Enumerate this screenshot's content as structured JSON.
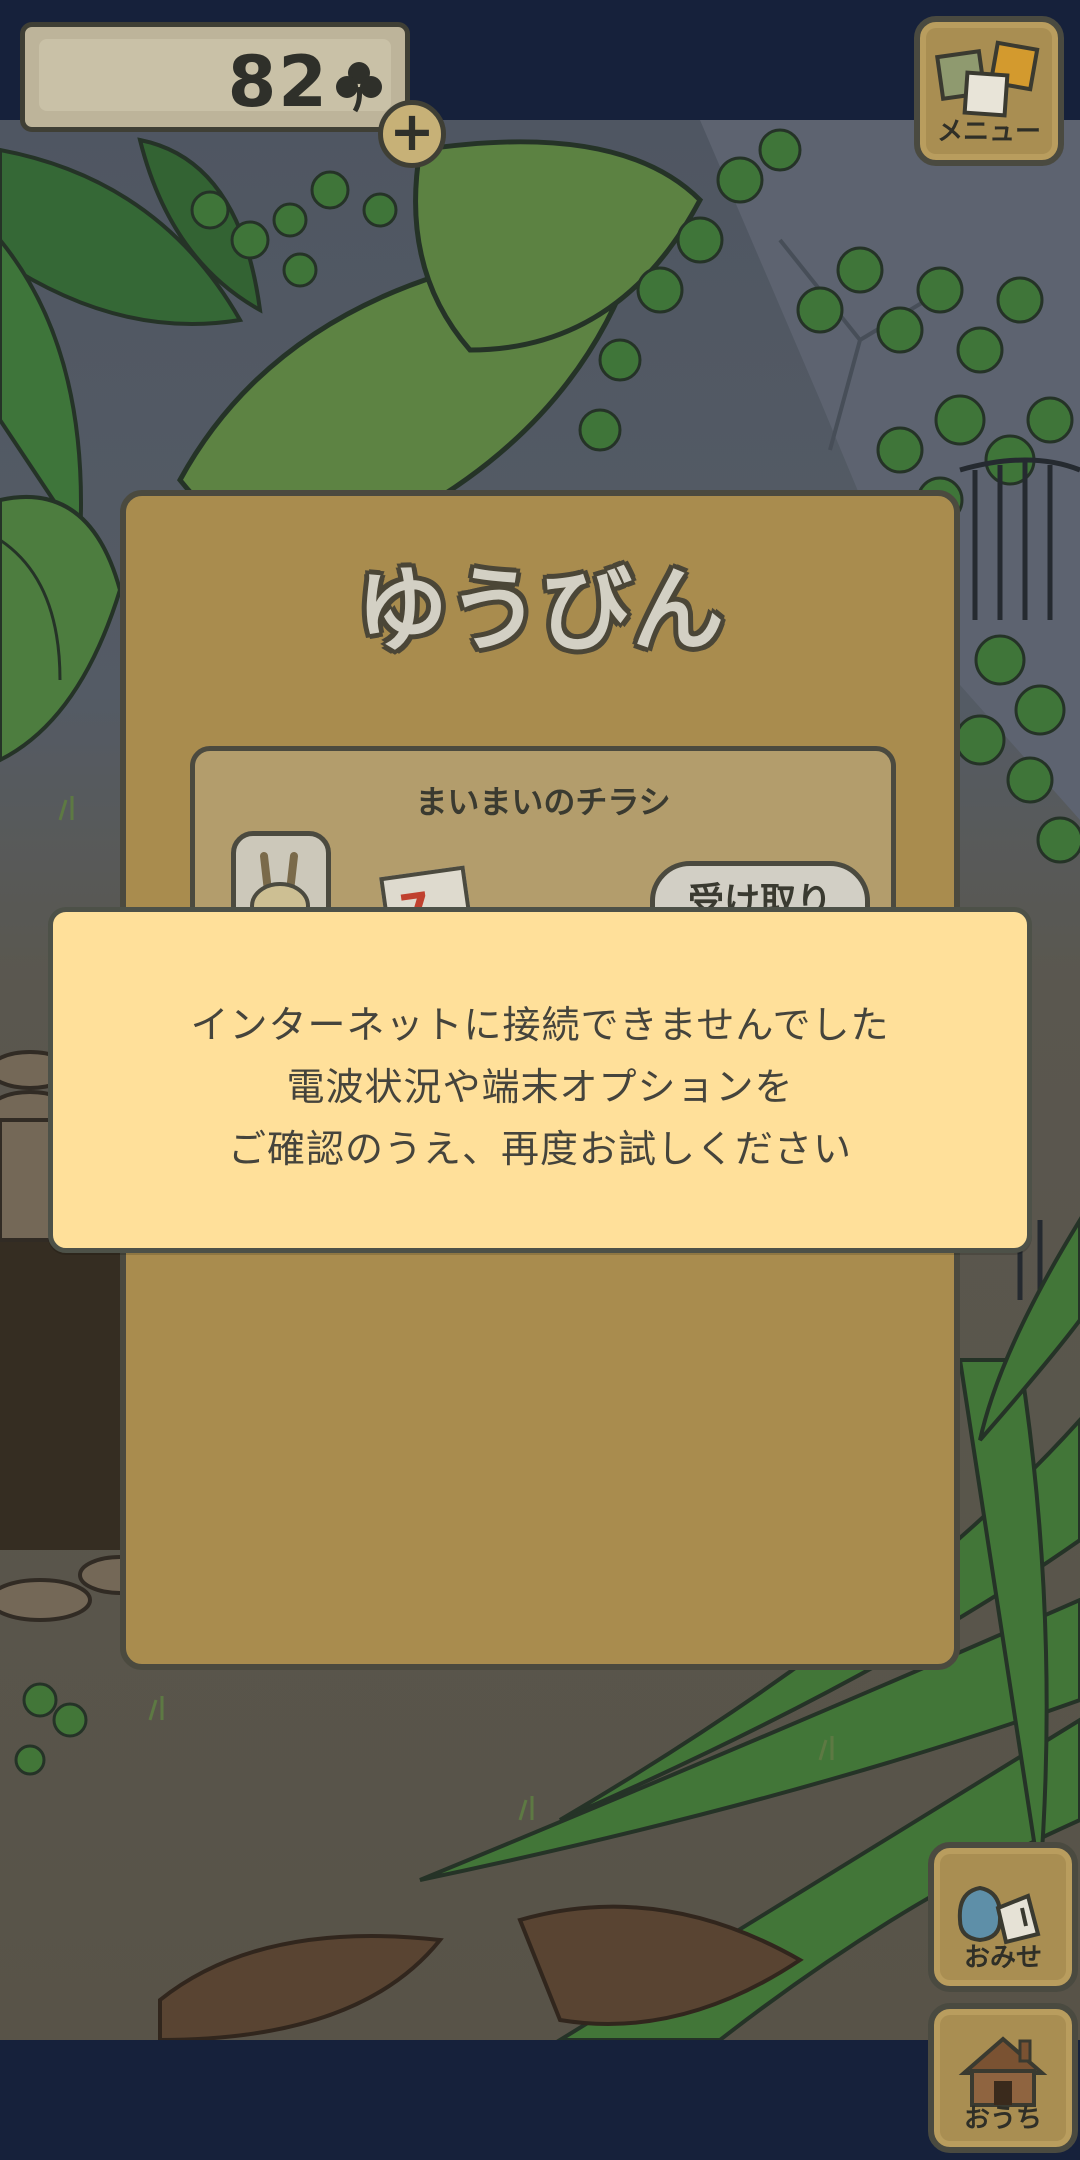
{
  "hud": {
    "clover_count": "82",
    "add_label": "+",
    "menu_label": "メニュー",
    "shop_label": "おみせ",
    "home_label": "おうち"
  },
  "mail": {
    "title": "ゆうびん",
    "item_sender": "まいまいのチラシ",
    "receive_label": "受け取り",
    "flyer_mark": "7"
  },
  "dialog": {
    "line1": "インターネットに接続できませんでした",
    "line2": "電波状況や端末オプションを",
    "line3": "ご確認のうえ、再度お試しください"
  },
  "colors": {
    "bar_navy": "#16213b",
    "panel_gold": "#a98c4e",
    "dialog_cream": "#ffe09a",
    "clover_green": "#2f302a"
  }
}
